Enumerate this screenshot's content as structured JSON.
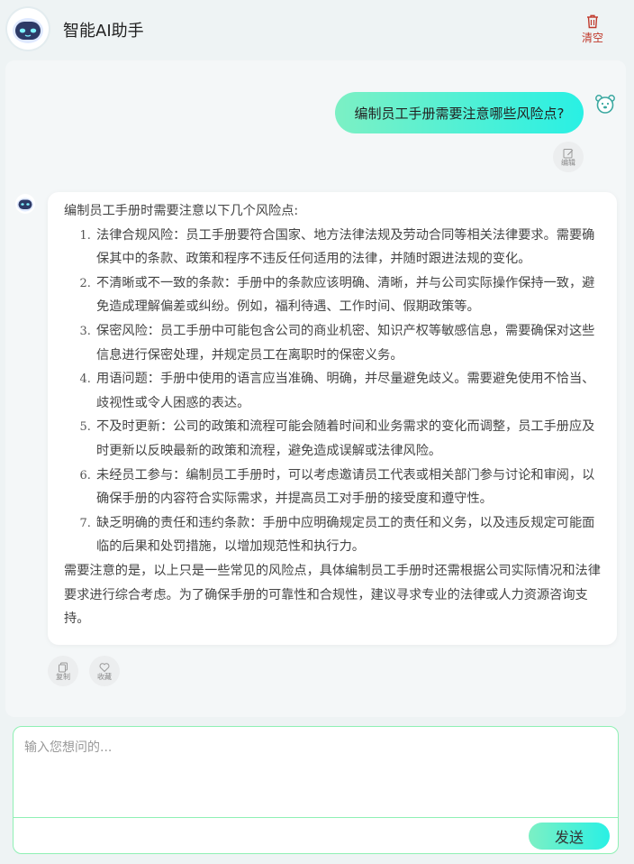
{
  "header": {
    "title": "智能AI助手",
    "clear_label": "清空"
  },
  "chat": {
    "user_message": "编制员工手册需要注意哪些风险点?",
    "edit_label": "编辑",
    "answer": {
      "intro": "编制员工手册时需要注意以下几个风险点:",
      "items": [
        "法律合规风险：员工手册要符合国家、地方法律法规及劳动合同等相关法律要求。需要确保其中的条款、政策和程序不违反任何适用的法律，并随时跟进法规的变化。",
        "不清晰或不一致的条款：手册中的条款应该明确、清晰，并与公司实际操作保持一致，避免造成理解偏差或纠纷。例如，福利待遇、工作时间、假期政策等。",
        "保密风险：员工手册中可能包含公司的商业机密、知识产权等敏感信息，需要确保对这些信息进行保密处理，并规定员工在离职时的保密义务。",
        "用语问题：手册中使用的语言应当准确、明确，并尽量避免歧义。需要避免使用不恰当、歧视性或令人困惑的表达。",
        "不及时更新：公司的政策和流程可能会随着时间和业务需求的变化而调整，员工手册应及时更新以反映最新的政策和流程，避免造成误解或法律风险。",
        "未经员工参与：编制员工手册时，可以考虑邀请员工代表或相关部门参与讨论和审阅，以确保手册的内容符合实际需求，并提高员工对手册的接受度和遵守性。",
        "缺乏明确的责任和违约条款：手册中应明确规定员工的责任和义务，以及违反规定可能面临的后果和处罚措施，以增加规范性和执行力。"
      ],
      "conclusion": "需要注意的是，以上只是一些常见的风险点，具体编制员工手册时还需根据公司实际情况和法律要求进行综合考虑。为了确保手册的可靠性和合规性，建议寻求专业的法律或人力资源咨询支持。"
    },
    "copy_label": "复制",
    "favorite_label": "收藏"
  },
  "input": {
    "placeholder": "输入您想问的...",
    "send_label": "发送"
  },
  "colors": {
    "accent_gradient_start": "#7cf0c4",
    "accent_gradient_end": "#29f0e4",
    "clear_red": "#c0392b",
    "input_border": "#8ff0b4"
  },
  "icons": {
    "app_logo": "robot-face-icon",
    "clear": "trash-icon",
    "user_avatar": "bear-face-icon",
    "edit": "edit-icon",
    "copy": "copy-icon",
    "favorite": "heart-icon"
  }
}
